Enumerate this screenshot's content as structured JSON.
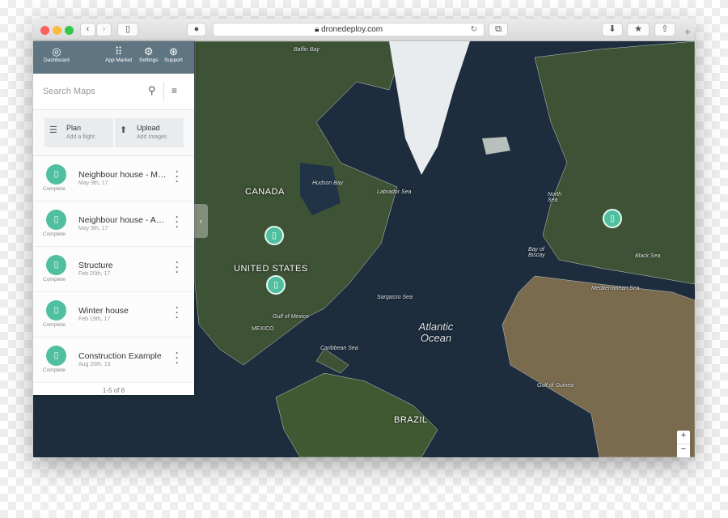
{
  "browser": {
    "url": "dronedeploy.com",
    "back": "‹",
    "forward": "›",
    "new_tab": "+"
  },
  "header": {
    "items": [
      {
        "label": "Dashboard",
        "icon": "dashboard-icon"
      },
      {
        "label": "App Market",
        "icon": "grid-icon"
      },
      {
        "label": "Settings",
        "icon": "gear-icon"
      },
      {
        "label": "Support",
        "icon": "lifebuoy-icon"
      }
    ]
  },
  "search": {
    "placeholder": "Search Maps"
  },
  "actions": [
    {
      "title": "Plan",
      "subtitle": "Add a flight"
    },
    {
      "title": "Upload",
      "subtitle": "Add Images"
    }
  ],
  "maps": [
    {
      "name": "Neighbour house - Ma...",
      "date": "May 9th, 17",
      "status": "Complete"
    },
    {
      "name": "Neighbour house - Apr...",
      "date": "May 9th, 17",
      "status": "Complete"
    },
    {
      "name": "Structure",
      "date": "Feb 20th, 17",
      "status": "Complete"
    },
    {
      "name": "Winter house",
      "date": "Feb 19th, 17",
      "status": "Complete"
    },
    {
      "name": "Construction Example",
      "date": "Aug 20th, 13",
      "status": "Complete"
    }
  ],
  "pagination": "1-5 of 6",
  "map_labels": {
    "baffin": "Baffin Bay",
    "canada": "CANADA",
    "hudson": "Hudson Bay",
    "labrador": "Labrador Sea",
    "us": "UNITED STATES",
    "gulf_mexico": "Gulf of Mexico",
    "mexico": "MEXICO",
    "caribbean": "Caribbean Sea",
    "sargasso": "Sargasso Sea",
    "atlantic": "Atlantic Ocean",
    "north_sea": "North Sea",
    "biscay": "Bay of Biscay",
    "black_sea": "Black Sea",
    "med": "Mediterranean Sea",
    "guinea": "Gulf of Guinea",
    "brazil": "BRAZIL"
  },
  "zoom": {
    "in": "+",
    "out": "−"
  },
  "colors": {
    "accent": "#4fbf9f",
    "header": "#5f7682",
    "ocean": "#1d2d3d"
  }
}
